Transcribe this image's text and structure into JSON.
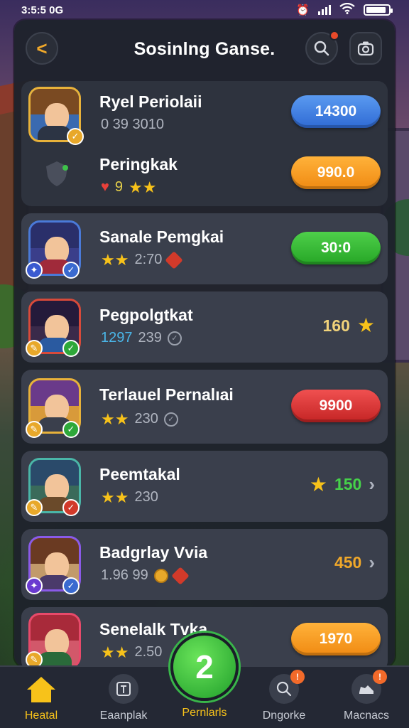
{
  "status_bar": {
    "time": "3:5:5 0G"
  },
  "header": {
    "back_label": "<",
    "title": "Sosinlng Ganse."
  },
  "players": [
    {
      "name": "Ryel Periolaii",
      "stat": "0 39 3010",
      "score": "14300",
      "button_color": "blue"
    },
    {
      "name": "Peringkak",
      "stat": "9",
      "score": "990.0",
      "button_color": "orange"
    },
    {
      "name": "Sanale Pemgkai",
      "stat": "2:70",
      "score": "30:0",
      "button_color": "green"
    },
    {
      "name": "Pegpolgtkat",
      "stat_colored": "1297",
      "stat": "239",
      "score": "160",
      "button_color": "none"
    },
    {
      "name": "Terlauel Pernalıai",
      "stat": "230",
      "score": "9900",
      "button_color": "red"
    },
    {
      "name": "Peemtakal",
      "stat": "230",
      "score": "150",
      "button_color": "none"
    },
    {
      "name": "Badgrlay Vvia",
      "stat": "1.96 99",
      "score": "450",
      "button_color": "none"
    },
    {
      "name": "Senelalk Tvka",
      "stat": "2.50",
      "score": "1970",
      "button_color": "orange"
    }
  ],
  "nav": {
    "items": [
      {
        "label": "Heatal",
        "icon": "home-icon",
        "active": true
      },
      {
        "label": "Eaanplak",
        "icon": "grid-icon"
      },
      {
        "label": "Pernlarls",
        "icon": "center-plus-icon"
      },
      {
        "label": "Dngorke",
        "icon": "search-icon",
        "badge": "!"
      },
      {
        "label": "Macnacs",
        "icon": "shoe-icon",
        "badge": "!"
      }
    ],
    "center_label": "2"
  },
  "colors": {
    "accent_gold": "#f7c21a",
    "score_green": "#38d24a",
    "score_orange": "#f0a82a"
  }
}
